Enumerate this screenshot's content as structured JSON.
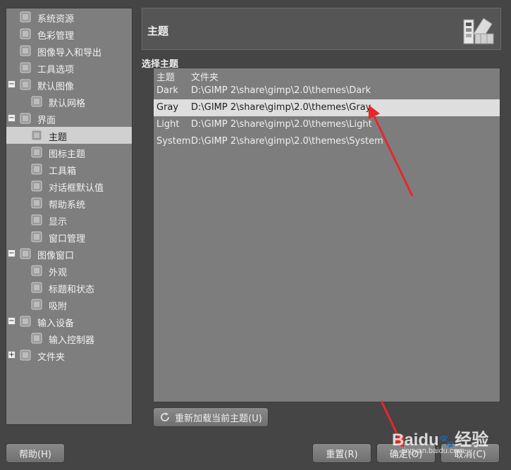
{
  "sidebar": {
    "items": [
      {
        "label": "系统资源",
        "icon": "system-resources-icon"
      },
      {
        "label": "色彩管理",
        "icon": "color-management-icon"
      },
      {
        "label": "图像导入和导出",
        "icon": "image-import-export-icon"
      },
      {
        "label": "工具选项",
        "icon": "tool-options-icon"
      },
      {
        "label": "默认图像",
        "icon": "default-image-icon",
        "expander": "−"
      },
      {
        "label": "默认网格",
        "icon": "default-grid-icon"
      },
      {
        "label": "界面",
        "icon": "interface-icon",
        "expander": "−"
      },
      {
        "label": "主题",
        "icon": "theme-icon",
        "selected": true
      },
      {
        "label": "图标主题",
        "icon": "icon-theme-icon"
      },
      {
        "label": "工具箱",
        "icon": "toolbox-icon"
      },
      {
        "label": "对话框默认值",
        "icon": "dialog-defaults-icon"
      },
      {
        "label": "帮助系统",
        "icon": "help-system-icon"
      },
      {
        "label": "显示",
        "icon": "display-icon"
      },
      {
        "label": "窗口管理",
        "icon": "window-management-icon"
      },
      {
        "label": "图像窗口",
        "icon": "image-window-icon",
        "expander": "−"
      },
      {
        "label": "外观",
        "icon": "appearance-icon"
      },
      {
        "label": "标题和状态",
        "icon": "title-status-icon"
      },
      {
        "label": "吸附",
        "icon": "snapping-icon"
      },
      {
        "label": "输入设备",
        "icon": "input-devices-icon",
        "expander": "−"
      },
      {
        "label": "输入控制器",
        "icon": "input-controllers-icon"
      },
      {
        "label": "文件夹",
        "icon": "folders-icon",
        "expander": "+"
      }
    ]
  },
  "header": {
    "title": "主题",
    "icon": "theme-palette-icon"
  },
  "section_label": "选择主题",
  "theme_list": {
    "columns": [
      "主题",
      "文件夹"
    ],
    "rows": [
      {
        "name": "Dark",
        "folder": "D:\\GIMP 2\\share\\gimp\\2.0\\themes\\Dark"
      },
      {
        "name": "Gray",
        "folder": "D:\\GIMP 2\\share\\gimp\\2.0\\themes\\Gray",
        "selected": true
      },
      {
        "name": "Light",
        "folder": "D:\\GIMP 2\\share\\gimp\\2.0\\themes\\Light"
      },
      {
        "name": "System",
        "folder": "D:\\GIMP 2\\share\\gimp\\2.0\\themes\\System"
      }
    ]
  },
  "buttons": {
    "reload": "重新加载当前主题(U)",
    "help": "帮助(H)",
    "reset": "重置(R)",
    "ok": "确定(O)",
    "cancel": "取消(C)"
  },
  "watermark": {
    "brand": "Baidu",
    "text": "经验",
    "url": "jingyan.baidu.com"
  },
  "colors": {
    "selection": "#dedede",
    "arrow": "#e8262a",
    "panel": "#7e7e7e"
  }
}
